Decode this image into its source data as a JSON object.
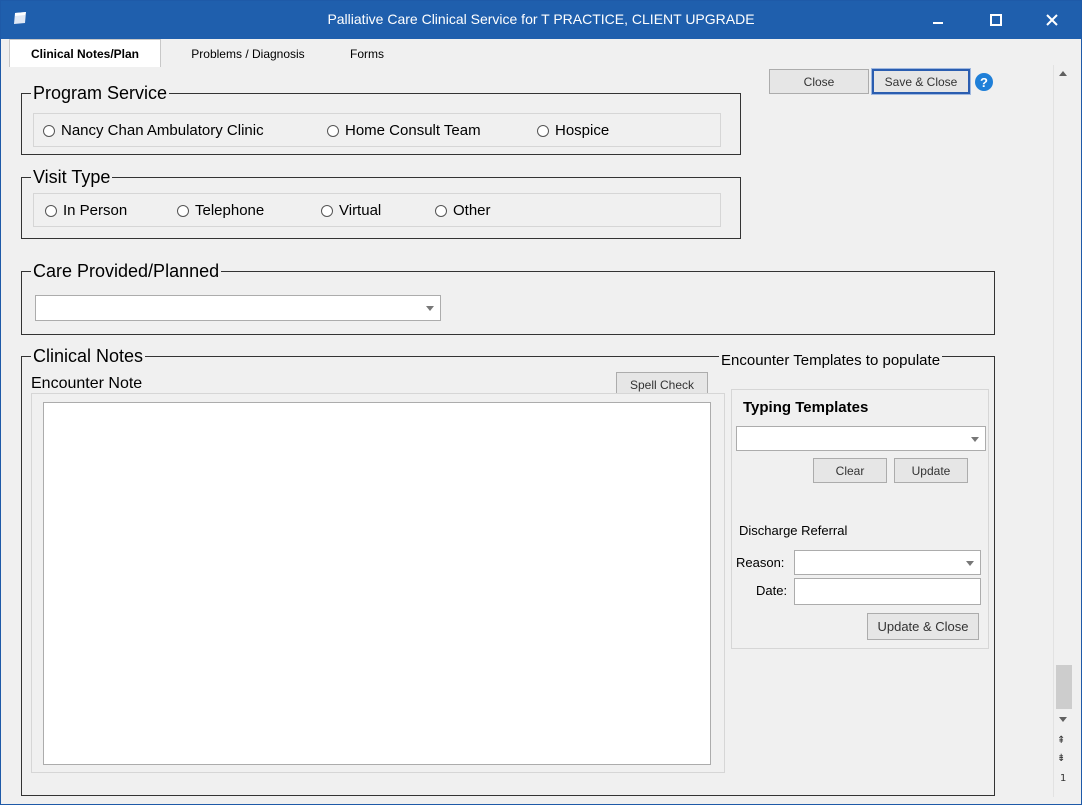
{
  "window": {
    "title": "Palliative Care Clinical Service for T PRACTICE, CLIENT UPGRADE",
    "controls": {
      "minimize": "–",
      "maximize": "☐",
      "close": "✕"
    }
  },
  "tabs": [
    {
      "label": "Clinical Notes/Plan",
      "active": true
    },
    {
      "label": "Problems / Diagnosis",
      "active": false
    },
    {
      "label": "Forms",
      "active": false
    }
  ],
  "toolbar": {
    "close_label": "Close",
    "save_close_label": "Save & Close",
    "help_label": "?"
  },
  "program_service": {
    "legend": "Program Service",
    "options": [
      "Nancy Chan Ambulatory Clinic",
      "Home Consult Team",
      "Hospice"
    ]
  },
  "visit_type": {
    "legend": "Visit Type",
    "options": [
      "In Person",
      "Telephone",
      "Virtual",
      "Other"
    ]
  },
  "care_provided": {
    "legend": "Care Provided/Planned",
    "value": ""
  },
  "clinical_notes": {
    "legend": "Clinical Notes",
    "encounter_note_label": "Encounter Note",
    "spell_check_label": "Spell Check",
    "note_text": ""
  },
  "encounter_templates": {
    "legend": "Encounter Templates to populate",
    "typing_templates_label": "Typing Templates",
    "typing_templates_value": "",
    "clear_label": "Clear",
    "update_label": "Update",
    "discharge_referral_label": "Discharge Referral",
    "reason_label": "Reason:",
    "reason_value": "",
    "date_label": "Date:",
    "date_value": "",
    "update_close_label": "Update & Close"
  },
  "scrollbar": {
    "page_number": "1"
  },
  "colors": {
    "titlebar": "#1f5fad",
    "background": "#f0f0f0",
    "accent": "#2a5db0"
  },
  "icons": [
    "app-icon",
    "minimize-icon",
    "maximize-icon",
    "close-icon",
    "help-icon",
    "radio-icon",
    "chevron-down-icon",
    "scroll-up-icon",
    "scroll-down-icon"
  ]
}
